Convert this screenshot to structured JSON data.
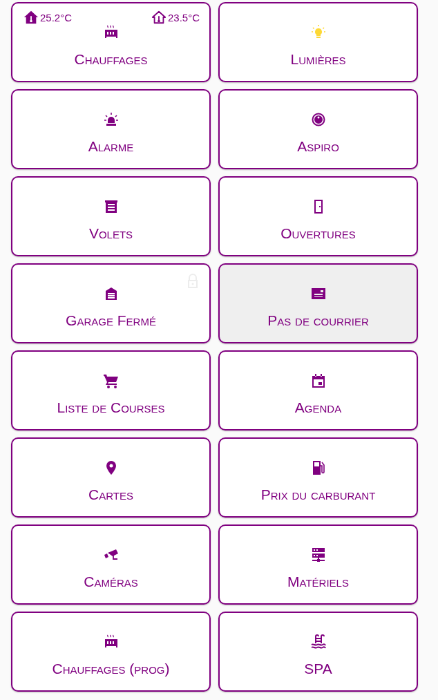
{
  "tiles": [
    {
      "kind": "heating",
      "label": "Chauffages",
      "color": "#800080",
      "dimmed": false,
      "locked": false,
      "readings": [
        {
          "kind": "filled",
          "text": "25.2°C"
        },
        {
          "kind": "outline",
          "text": "23.5°C"
        }
      ]
    },
    {
      "kind": "light",
      "label": "Lumières",
      "color": "#fdd835",
      "dimmed": false,
      "locked": false
    },
    {
      "kind": "siren",
      "label": "Alarme",
      "color": "#800080",
      "dimmed": false,
      "locked": false
    },
    {
      "kind": "vacuum",
      "label": "Aspiro",
      "color": "#800080",
      "dimmed": false,
      "locked": false
    },
    {
      "kind": "shutter",
      "label": "Volets",
      "color": "#800080",
      "dimmed": false,
      "locked": false
    },
    {
      "kind": "door",
      "label": "Ouvertures",
      "color": "#800080",
      "dimmed": false,
      "locked": false
    },
    {
      "kind": "garage",
      "label": "Garage Fermé",
      "color": "#800080",
      "dimmed": false,
      "locked": true
    },
    {
      "kind": "mailbox",
      "label": "Pas de courrier",
      "color": "#800080",
      "dimmed": true,
      "locked": false
    },
    {
      "kind": "cart",
      "label": "Liste de Courses",
      "color": "#800080",
      "dimmed": false,
      "locked": false
    },
    {
      "kind": "calendar",
      "label": "Agenda",
      "color": "#800080",
      "dimmed": false,
      "locked": false
    },
    {
      "kind": "pin",
      "label": "Cartes",
      "color": "#800080",
      "dimmed": false,
      "locked": false
    },
    {
      "kind": "fuel",
      "label": "Prix du carburant",
      "color": "#800080",
      "dimmed": false,
      "locked": false
    },
    {
      "kind": "camera",
      "label": "Caméras",
      "color": "#800080",
      "dimmed": false,
      "locked": false
    },
    {
      "kind": "server",
      "label": "Matériels",
      "color": "#800080",
      "dimmed": false,
      "locked": false
    },
    {
      "kind": "heating",
      "label": "Chauffages (prog)",
      "color": "#800080",
      "dimmed": false,
      "locked": false
    },
    {
      "kind": "pool",
      "label": "SPA",
      "color": "#800080",
      "dimmed": false,
      "locked": false
    }
  ]
}
